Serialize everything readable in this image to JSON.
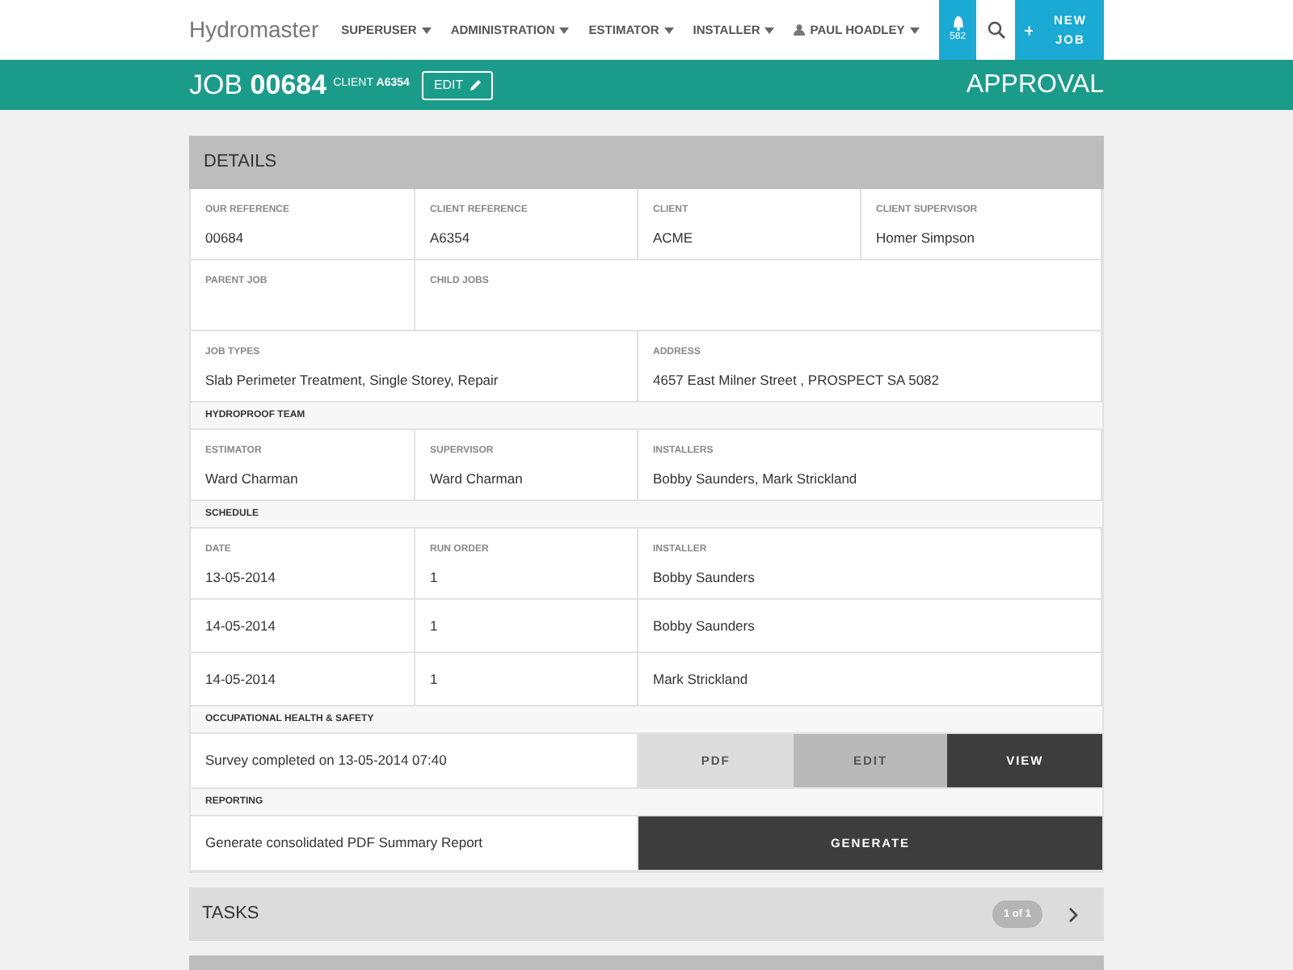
{
  "navbar": {
    "brand": "Hydromaster",
    "menus": [
      {
        "label": "SUPERUSER"
      },
      {
        "label": "ADMINISTRATION"
      },
      {
        "label": "ESTIMATOR"
      },
      {
        "label": "INSTALLER"
      }
    ],
    "user": "PAUL HOADLEY",
    "notifications": "582",
    "new_job": "NEW JOB"
  },
  "job_bar": {
    "prefix": "JOB",
    "number": "00684",
    "client_label": "CLIENT",
    "client_value": "A6354",
    "edit": "EDIT",
    "status": "APPROVAL"
  },
  "details": {
    "title": "DETAILS",
    "rows": [
      {
        "kind": "four",
        "cells": [
          {
            "label": "OUR REFERENCE",
            "value": "00684"
          },
          {
            "label": "CLIENT REFERENCE",
            "value": "A6354"
          },
          {
            "label": "CLIENT",
            "value": "ACME"
          },
          {
            "label": "CLIENT SUPERVISOR",
            "value": "Homer Simpson"
          }
        ]
      },
      {
        "kind": "one_three",
        "cells": [
          {
            "label": "PARENT JOB"
          },
          {
            "label": "CHILD JOBS"
          }
        ]
      },
      {
        "kind": "two_two",
        "cells": [
          {
            "label": "JOB TYPES",
            "value": "Slab Perimeter Treatment, Single Storey, Repair"
          },
          {
            "label": "ADDRESS",
            "value": "4657 East Milner Street , PROSPECT SA 5082"
          }
        ]
      },
      {
        "kind": "heading",
        "title": "HYDROPROOF TEAM"
      },
      {
        "kind": "one_one_two",
        "cells": [
          {
            "label": "ESTIMATOR",
            "value": "Ward Charman"
          },
          {
            "label": "SUPERVISOR",
            "value": "Ward Charman"
          },
          {
            "label": "INSTALLERS",
            "value": "Bobby Saunders, Mark Strickland"
          }
        ]
      },
      {
        "kind": "heading",
        "title": "SCHEDULE"
      },
      {
        "kind": "one_one_two",
        "cells": [
          {
            "label": "DATE",
            "value": "13-05-2014"
          },
          {
            "label": "RUN ORDER",
            "value": "1"
          },
          {
            "label": "INSTALLER",
            "value": "Bobby Saunders"
          }
        ]
      },
      {
        "kind": "one_one_two",
        "cells": [
          {
            "value": "14-05-2014"
          },
          {
            "value": "1"
          },
          {
            "value": "Bobby Saunders"
          }
        ]
      },
      {
        "kind": "one_one_two",
        "cells": [
          {
            "value": "14-05-2014"
          },
          {
            "value": "1"
          },
          {
            "value": "Mark Strickland"
          }
        ]
      },
      {
        "kind": "heading",
        "title": "OCCUPATIONAL HEALTH & SAFETY"
      },
      {
        "kind": "action",
        "text": "Survey completed on 13-05-2014 07:40",
        "buttons": [
          {
            "label": "PDF",
            "kind": "light"
          },
          {
            "label": "EDIT",
            "kind": "mid"
          },
          {
            "label": "VIEW",
            "kind": "dark"
          }
        ]
      },
      {
        "kind": "heading",
        "title": "REPORTING"
      },
      {
        "kind": "action",
        "text": "Generate consolidated PDF Summary Report",
        "buttons": [
          {
            "label": "GENERATE",
            "kind": "dark"
          }
        ]
      }
    ]
  },
  "tasks": {
    "title": "TASKS",
    "badge": "1 of 1"
  }
}
